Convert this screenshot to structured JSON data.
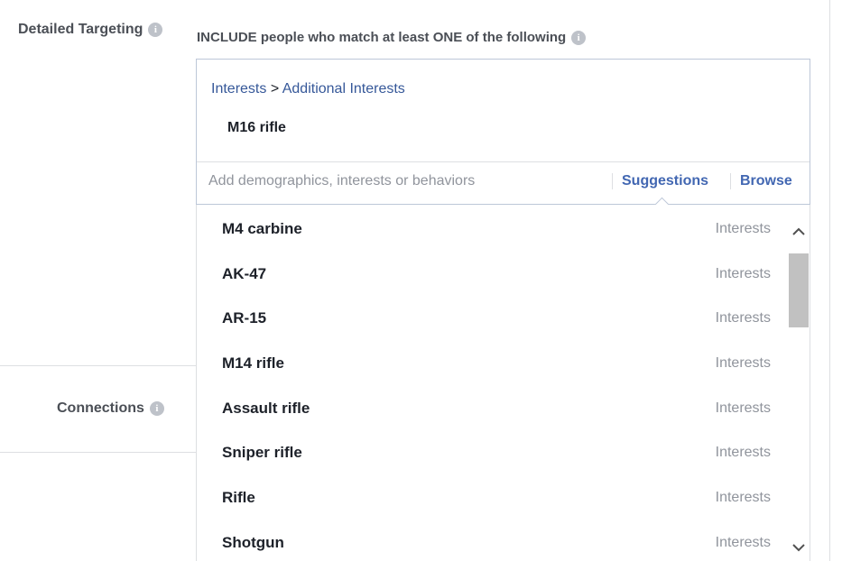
{
  "labels": {
    "detailed_targeting": "Detailed Targeting",
    "connections": "Connections",
    "info_glyph": "i"
  },
  "include_text": "INCLUDE people who match at least ONE of the following",
  "breadcrumb": {
    "category": "Interests",
    "separator": ">",
    "subcategory": "Additional Interests"
  },
  "selected_item": "M16 rifle",
  "search": {
    "placeholder": "Add demographics, interests or behaviors",
    "value": ""
  },
  "tabs": {
    "suggestions": "Suggestions",
    "browse": "Browse"
  },
  "suggestions": [
    {
      "name": "M4 carbine",
      "type": "Interests"
    },
    {
      "name": "AK-47",
      "type": "Interests"
    },
    {
      "name": "AR-15",
      "type": "Interests"
    },
    {
      "name": "M14 rifle",
      "type": "Interests"
    },
    {
      "name": "Assault rifle",
      "type": "Interests"
    },
    {
      "name": "Sniper rifle",
      "type": "Interests"
    },
    {
      "name": "Rifle",
      "type": "Interests"
    },
    {
      "name": "Shotgun",
      "type": "Interests"
    }
  ],
  "colors": {
    "link": "#365899",
    "accent": "#4267b2",
    "muted": "#90949c",
    "border": "#bdc7d8"
  },
  "icons": {
    "info": "info-icon",
    "scroll_up": "chevron-up-icon",
    "scroll_down": "chevron-down-icon"
  }
}
